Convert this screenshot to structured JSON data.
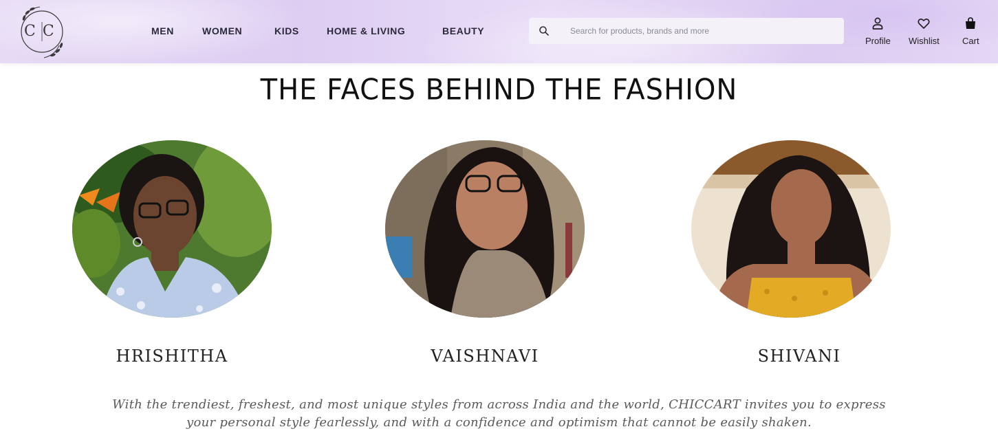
{
  "brand": {
    "logo_text": "CC"
  },
  "nav": {
    "items": [
      {
        "label": "MEN"
      },
      {
        "label": "WOMEN"
      },
      {
        "label": "KIDS"
      },
      {
        "label": "HOME & LIVING"
      },
      {
        "label": "BEAUTY"
      }
    ]
  },
  "search": {
    "placeholder": "Search for products, brands and more",
    "value": ""
  },
  "actions": {
    "profile": {
      "label": "Profile",
      "icon": "user-icon"
    },
    "wishlist": {
      "label": "Wishlist",
      "icon": "heart-icon"
    },
    "cart": {
      "label": "Cart",
      "icon": "bag-icon"
    }
  },
  "main": {
    "title": "THE FACES BEHIND THE FASHION",
    "team": [
      {
        "name": "HRISHITHA"
      },
      {
        "name": "VAISHNAVI"
      },
      {
        "name": "SHIVANI"
      }
    ],
    "tagline_line1": "With the trendiest, freshest, and most unique styles from across India and the world, CHICCART invites you to express",
    "tagline_line2": "your personal style fearlessly, and with a confidence and optimism that cannot be easily shaken."
  },
  "colors": {
    "header_bg": "#e2d4f4",
    "text": "#111111",
    "tagline": "#5a5a5a"
  }
}
